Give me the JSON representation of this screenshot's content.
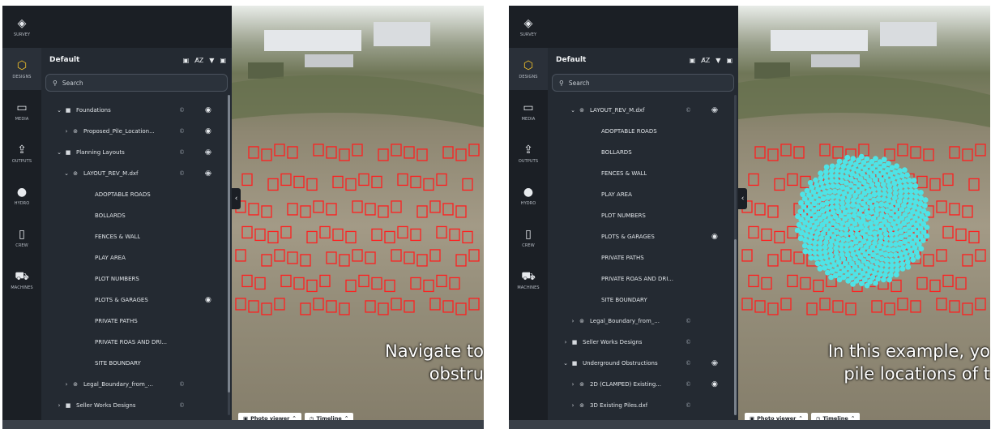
{
  "rail": {
    "items": [
      {
        "label": "SURVEY",
        "icon": "◈"
      },
      {
        "label": "DESIGNS",
        "icon": "⬡"
      },
      {
        "label": "MEDIA",
        "icon": "▭"
      },
      {
        "label": "OUTPUTS",
        "icon": "⇪"
      },
      {
        "label": "HYDRO",
        "icon": "●"
      },
      {
        "label": "CREW",
        "icon": "▯"
      },
      {
        "label": "MACHINES",
        "icon": "⛟"
      }
    ],
    "active_color": "#f2c22b"
  },
  "tree": {
    "title": "Default",
    "tools": {
      "folder": "▣",
      "sort": "A̸Z",
      "filter": "▼",
      "add": "▣"
    },
    "search_placeholder": "Search",
    "search_glyph": "⚲",
    "badge": "©"
  },
  "left": {
    "rows": [
      {
        "label": "Foundations",
        "chev": "⌄",
        "kind": "■",
        "depth": 1,
        "badge": true,
        "vis": "on"
      },
      {
        "label": "Proposed_Pile_Location...",
        "chev": "›",
        "kind": "⊚",
        "depth": 2,
        "badge": true,
        "vis": "on"
      },
      {
        "label": "Planning Layouts",
        "chev": "⌄",
        "kind": "■",
        "depth": 1,
        "badge": true,
        "vis": "off"
      },
      {
        "label": "LAYOUT_REV_M.dxf",
        "chev": "⌄",
        "kind": "⊚",
        "depth": 2,
        "badge": true,
        "vis": "off"
      },
      {
        "label": "ADOPTABLE ROADS",
        "chev": "",
        "kind": "",
        "depth": 4,
        "badge": false,
        "vis": ""
      },
      {
        "label": "BOLLARDS",
        "chev": "",
        "kind": "",
        "depth": 4,
        "badge": false,
        "vis": ""
      },
      {
        "label": "FENCES & WALL",
        "chev": "",
        "kind": "",
        "depth": 4,
        "badge": false,
        "vis": ""
      },
      {
        "label": "PLAY AREA",
        "chev": "",
        "kind": "",
        "depth": 4,
        "badge": false,
        "vis": ""
      },
      {
        "label": "PLOT NUMBERS",
        "chev": "",
        "kind": "",
        "depth": 4,
        "badge": false,
        "vis": ""
      },
      {
        "label": "PLOTS & GARAGES",
        "chev": "",
        "kind": "",
        "depth": 4,
        "badge": false,
        "vis": "on"
      },
      {
        "label": "PRIVATE PATHS",
        "chev": "",
        "kind": "",
        "depth": 4,
        "badge": false,
        "vis": ""
      },
      {
        "label": "PRIVATE ROAS AND DRI...",
        "chev": "",
        "kind": "",
        "depth": 4,
        "badge": false,
        "vis": ""
      },
      {
        "label": "SITE BOUNDARY",
        "chev": "",
        "kind": "",
        "depth": 4,
        "badge": false,
        "vis": ""
      },
      {
        "label": "Legal_Boundary_from_...",
        "chev": "›",
        "kind": "⊚",
        "depth": 2,
        "badge": true,
        "vis": ""
      },
      {
        "label": "Seller Works Designs",
        "chev": "›",
        "kind": "■",
        "depth": 1,
        "badge": true,
        "vis": ""
      }
    ],
    "caption_lines": [
      "Navigate to",
      "obstru"
    ],
    "scroll_fraction_top": 0.0,
    "scroll_fraction_size": 0.93
  },
  "right": {
    "rows": [
      {
        "label": "LAYOUT_REV_M.dxf",
        "chev": "⌄",
        "kind": "⊚",
        "depth": 2,
        "badge": true,
        "vis": "off"
      },
      {
        "label": "ADOPTABLE ROADS",
        "chev": "",
        "kind": "",
        "depth": 4,
        "badge": false,
        "vis": ""
      },
      {
        "label": "BOLLARDS",
        "chev": "",
        "kind": "",
        "depth": 4,
        "badge": false,
        "vis": ""
      },
      {
        "label": "FENCES & WALL",
        "chev": "",
        "kind": "",
        "depth": 4,
        "badge": false,
        "vis": ""
      },
      {
        "label": "PLAY AREA",
        "chev": "",
        "kind": "",
        "depth": 4,
        "badge": false,
        "vis": ""
      },
      {
        "label": "PLOT NUMBERS",
        "chev": "",
        "kind": "",
        "depth": 4,
        "badge": false,
        "vis": ""
      },
      {
        "label": "PLOTS & GARAGES",
        "chev": "",
        "kind": "",
        "depth": 4,
        "badge": false,
        "vis": "on"
      },
      {
        "label": "PRIVATE PATHS",
        "chev": "",
        "kind": "",
        "depth": 4,
        "badge": false,
        "vis": ""
      },
      {
        "label": "PRIVATE ROAS AND DRI...",
        "chev": "",
        "kind": "",
        "depth": 4,
        "badge": false,
        "vis": ""
      },
      {
        "label": "SITE BOUNDARY",
        "chev": "",
        "kind": "",
        "depth": 4,
        "badge": false,
        "vis": ""
      },
      {
        "label": "Legal_Boundary_from_...",
        "chev": "›",
        "kind": "⊚",
        "depth": 2,
        "badge": true,
        "vis": ""
      },
      {
        "label": "Seller Works Designs",
        "chev": "›",
        "kind": "■",
        "depth": 1,
        "badge": true,
        "vis": ""
      },
      {
        "label": "Underground Obstructions",
        "chev": "⌄",
        "kind": "■",
        "depth": 1,
        "badge": true,
        "vis": "off"
      },
      {
        "label": "2D (CLAMPED) Existing...",
        "chev": "›",
        "kind": "⊚",
        "depth": 2,
        "badge": true,
        "vis": "on"
      },
      {
        "label": "3D Existing Piles.dxf",
        "chev": "›",
        "kind": "⊚",
        "depth": 2,
        "badge": true,
        "vis": ""
      }
    ],
    "caption_lines": [
      "In this example, yo",
      "pile locations of t"
    ],
    "scroll_fraction_top": 0.45,
    "scroll_fraction_size": 0.55
  },
  "bottom": {
    "photo_viewer": "Photo viewer",
    "timeline": "Timeline",
    "photo_glyph": "▣",
    "timeline_glyph": "◷",
    "caret": "⌃"
  },
  "icons": {
    "eye_on": "◉",
    "eye_off": "◉",
    "collapse": "‹"
  },
  "colors": {
    "plot_outline": "#ff1f1f",
    "pile_marker": "#4fe3e6"
  }
}
